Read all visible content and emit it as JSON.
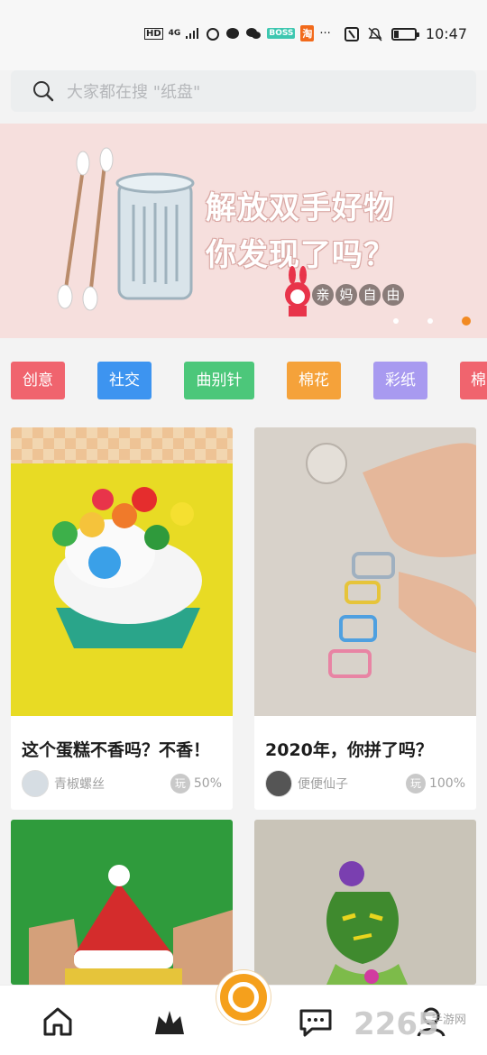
{
  "status_bar": {
    "net_label": "HD",
    "net_type": "4G",
    "app_chip_1": "BOSS",
    "app_chip_2": "淘",
    "more": "···",
    "time": "10:47"
  },
  "search": {
    "placeholder": "大家都在搜 \"纸盘\""
  },
  "banner": {
    "title_line1": "解放双手好物",
    "title_line2": "你发现了吗？",
    "brand_chars": [
      "亲",
      "妈",
      "自",
      "由"
    ],
    "active_dot": 3
  },
  "tags": [
    {
      "label": "创意",
      "color": "#f0646e"
    },
    {
      "label": "社交",
      "color": "#3d94f0"
    },
    {
      "label": "曲别针",
      "color": "#4cc77a"
    },
    {
      "label": "棉花",
      "color": "#f5a23a"
    },
    {
      "label": "彩纸",
      "color": "#a89af0"
    },
    {
      "label": "棉",
      "color": "#f0646e"
    }
  ],
  "cards": [
    {
      "title": "这个蛋糕不香吗？不香！",
      "author": "青椒螺丝",
      "play_icon": "玩",
      "percent": "50%"
    },
    {
      "title": "2020年，你拼了吗？",
      "author": "便便仙子",
      "play_icon": "玩",
      "percent": "100%"
    }
  ],
  "bottom_nav": [
    "home-icon",
    "crown-icon",
    "camera-button",
    "message-icon",
    "profile-icon"
  ],
  "watermark": {
    "number": "2265",
    "text": "手游网"
  },
  "colors": {
    "accent": "#f28a22",
    "banner_bg": "#f6dfdd"
  }
}
